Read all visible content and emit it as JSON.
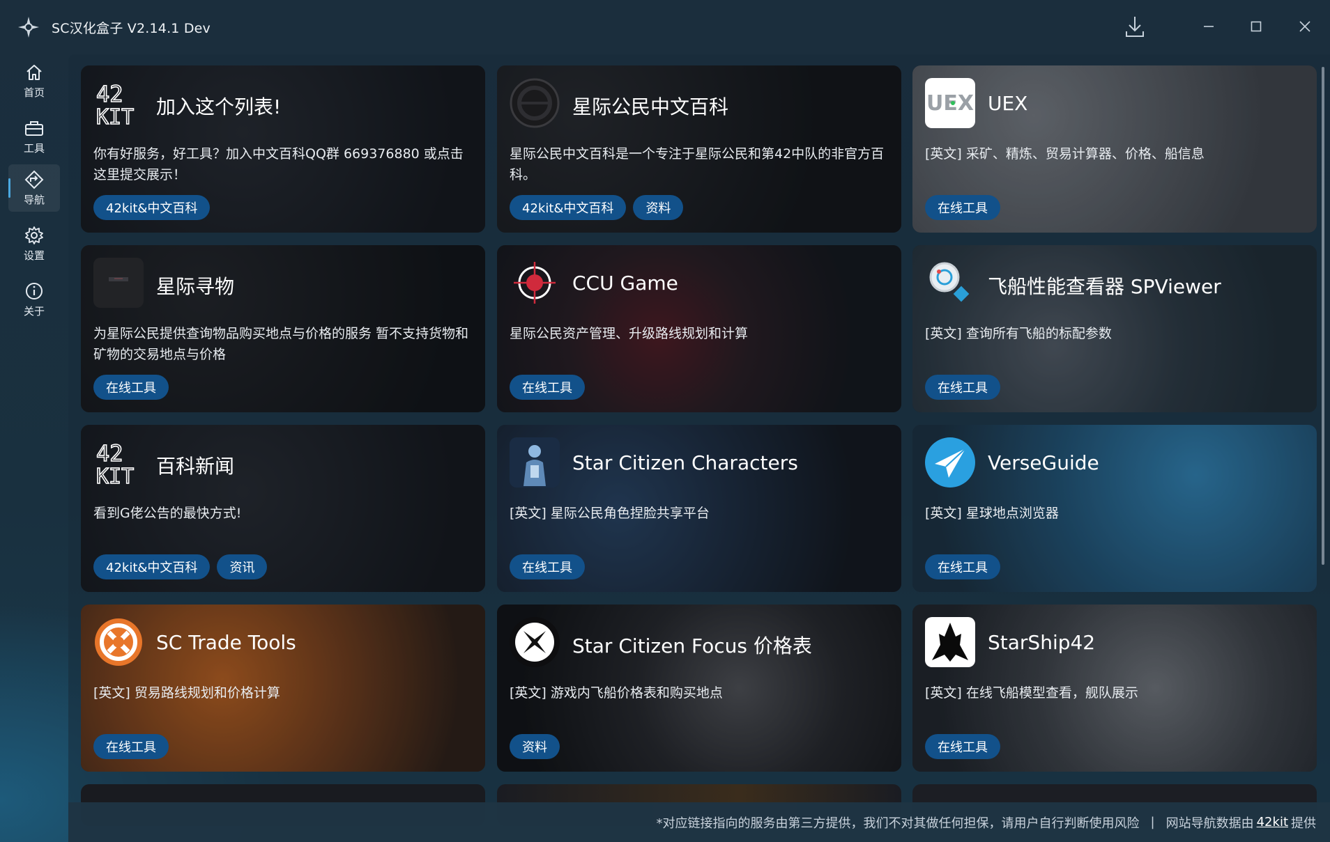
{
  "window": {
    "title": "SC汉化盒子 V2.14.1  Dev",
    "controls": [
      "download-icon",
      "minimize-icon",
      "maximize-icon",
      "close-icon"
    ]
  },
  "sidebar": {
    "items": [
      {
        "label": "首页",
        "icon": "home-icon"
      },
      {
        "label": "工具",
        "icon": "toolbox-icon"
      },
      {
        "label": "导航",
        "icon": "navigation-icon",
        "active": true
      },
      {
        "label": "设置",
        "icon": "gear-icon"
      },
      {
        "label": "关于",
        "icon": "info-icon"
      }
    ]
  },
  "cards": [
    {
      "title": "加入这个列表!",
      "desc": "你有好服务，好工具？加入中文百科QQ群 669376880 或点击这里提交展示！",
      "tags": [
        "42kit&中文百科"
      ],
      "icon": "42kit-logo-icon"
    },
    {
      "title": "星际公民中文百科",
      "desc": "星际公民中文百科是一个专注于星际公民和第42中队的非官方百科。",
      "tags": [
        "42kit&中文百科",
        "资料"
      ],
      "icon": "sc-wiki-logo-icon"
    },
    {
      "title": "UEX",
      "desc": "[英文] 采矿、精炼、贸易计算器、价格、船信息",
      "tags": [
        "在线工具"
      ],
      "icon": "uex-logo-icon"
    },
    {
      "title": "星际寻物",
      "desc": "为星际公民提供查询物品购买地点与价格的服务 暂不支持货物和矿物的交易地点与价格",
      "tags": [
        "在线工具"
      ],
      "icon": "item-finder-logo-icon"
    },
    {
      "title": "CCU Game",
      "desc": "星际公民资产管理、升级路线规划和计算",
      "tags": [
        "在线工具"
      ],
      "icon": "ccu-game-logo-icon"
    },
    {
      "title": "飞船性能查看器 SPViewer",
      "desc": "[英文] 查询所有飞船的标配参数",
      "tags": [
        "在线工具"
      ],
      "icon": "spviewer-logo-icon"
    },
    {
      "title": "百科新闻",
      "desc": "看到G佬公告的最快方式!",
      "tags": [
        "42kit&中文百科",
        "资讯"
      ],
      "icon": "42kit-logo-icon"
    },
    {
      "title": "Star Citizen Characters",
      "desc": "[英文] 星际公民角色捏脸共享平台",
      "tags": [
        "在线工具"
      ],
      "icon": "characters-logo-icon"
    },
    {
      "title": "VerseGuide",
      "desc": "[英文] 星球地点浏览器",
      "tags": [
        "在线工具"
      ],
      "icon": "verseguide-logo-icon"
    },
    {
      "title": "SC Trade Tools",
      "desc": "[英文] 贸易路线规划和价格计算",
      "tags": [
        "在线工具"
      ],
      "icon": "sc-trade-tools-logo-icon"
    },
    {
      "title": "Star Citizen Focus 价格表",
      "desc": "[英文] 游戏内飞船价格表和购买地点",
      "tags": [
        "资料"
      ],
      "icon": "sc-focus-logo-icon"
    },
    {
      "title": "StarShip42",
      "desc": "[英文] 在线飞船模型查看，舰队展示",
      "tags": [
        "在线工具"
      ],
      "icon": "starship42-logo-icon"
    }
  ],
  "colors": {
    "tag_bg": "#12518a",
    "accent": "#4aa8e0"
  },
  "footer": {
    "disclaimer": "*对应链接指向的服务由第三方提供，我们不对其做任何担保，请用户自行判断使用风险",
    "separator": "|",
    "credit_prefix": "网站导航数据由",
    "credit_link": "42kit",
    "credit_suffix": "提供"
  }
}
